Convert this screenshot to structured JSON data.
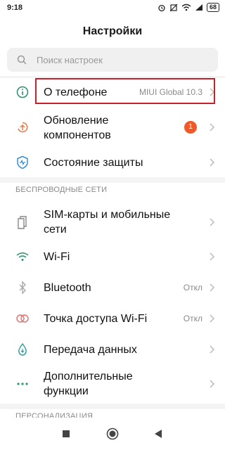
{
  "status_bar": {
    "time": "9:18",
    "battery": "68"
  },
  "header": {
    "title": "Настройки"
  },
  "search": {
    "placeholder": "Поиск настроек"
  },
  "rows": {
    "about": {
      "label": "О телефоне",
      "value": "MIUI Global 10.3"
    },
    "updates": {
      "label_line1": "Обновление",
      "label_line2": "компонентов",
      "badge": "1"
    },
    "security": {
      "label": "Состояние защиты"
    },
    "sim": {
      "label_line1": "SIM-карты и мобильные",
      "label_line2": "сети"
    },
    "wifi": {
      "label": "Wi-Fi"
    },
    "bluetooth": {
      "label": "Bluetooth",
      "value": "Откл"
    },
    "hotspot": {
      "label": "Точка доступа Wi-Fi",
      "value": "Откл"
    },
    "data": {
      "label": "Передача данных"
    },
    "more": {
      "label_line1": "Дополнительные",
      "label_line2": "функции"
    }
  },
  "sections": {
    "wireless": "БЕСПРОВОДНЫЕ СЕТИ",
    "personalization": "ПЕРСОНАЛИЗАЦИЯ"
  },
  "colors": {
    "accent": "#c8202b",
    "badge": "#f05a28"
  },
  "icons": {
    "about": "info-icon",
    "updates": "update-arrow-icon",
    "security": "shield-icon",
    "sim": "sim-card-icon",
    "wifi": "wifi-icon",
    "bluetooth": "bluetooth-icon",
    "hotspot": "hotspot-icon",
    "data": "data-drop-icon",
    "more": "dots-icon"
  }
}
